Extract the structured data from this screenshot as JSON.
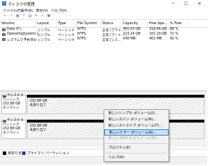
{
  "window": {
    "title": "ディスクの管理",
    "minimize": "─",
    "maximize": "☐",
    "close": "✕"
  },
  "menus": [
    "ファイル(F)",
    "操作(A)",
    "表示(V)",
    "ヘルプ(H)"
  ],
  "toolbar": [
    "←",
    "→",
    "▦",
    "?",
    "▤",
    "✎",
    "✓",
    "▣"
  ],
  "columns": [
    "Volume",
    "Layout",
    "Type",
    "File System",
    "Status",
    "Capacity",
    "Free Spa...",
    "% Free"
  ],
  "volumes": [
    {
      "name": "Data (F:)",
      "layout": "シンプル",
      "type": "ベーシック",
      "fs": "NTFS",
      "status": "正常 (プライ...",
      "capacity": "465.63 GB",
      "free": "318.66 GB",
      "pct": "68 %"
    },
    {
      "name": "OperatingSystem (...",
      "layout": "シンプル",
      "type": "ベーシック",
      "fs": "NTFS",
      "status": "正常 (ブート...",
      "capacity": "223.14 GB",
      "free": "161.19 GB",
      "pct": "72 %"
    },
    {
      "name": "システムで予約済み",
      "layout": "シンプル",
      "type": "ベーシック",
      "fs": "NTFS",
      "status": "正常 (シス...",
      "capacity": "436 MB",
      "free": "402 MB",
      "pct": "92 %"
    }
  ],
  "disks": [
    {
      "name": "ディスク 2",
      "kind": "ベーシック",
      "size": "232.88 GB",
      "state": "オンライン",
      "part_size": "232.88 GB",
      "part_label": "未割り当て"
    },
    {
      "name": "ディスク 3",
      "kind": "ベーシック",
      "size": "232.88 GB",
      "state": "オンライン",
      "part_size": "232.88 GB",
      "part_label": "未割り当て"
    }
  ],
  "legend": [
    "未割り当て",
    "プライマリ パーティション"
  ],
  "context_menu": [
    "新しいシンプル ボリューム(I)...",
    "新しいスパン ボリューム(N)...",
    "新しいストライプ ボリューム(T)...",
    "新しいミラー ボリューム(R)...",
    "新しい RAID-5 ボリューム(W)...",
    "プロパティ(P)",
    "ヘルプ(H)"
  ],
  "colors": {
    "unallocated": "#000000",
    "primary": "#1f3fa8",
    "highlight": "#cce4f7"
  }
}
